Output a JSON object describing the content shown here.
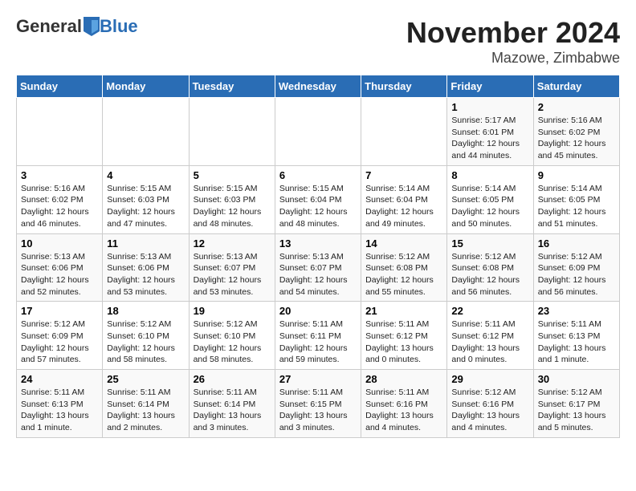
{
  "header": {
    "logo_general": "General",
    "logo_blue": "Blue",
    "title": "November 2024",
    "subtitle": "Mazowe, Zimbabwe"
  },
  "days_of_week": [
    "Sunday",
    "Monday",
    "Tuesday",
    "Wednesday",
    "Thursday",
    "Friday",
    "Saturday"
  ],
  "weeks": [
    [
      {
        "day": "",
        "info": ""
      },
      {
        "day": "",
        "info": ""
      },
      {
        "day": "",
        "info": ""
      },
      {
        "day": "",
        "info": ""
      },
      {
        "day": "",
        "info": ""
      },
      {
        "day": "1",
        "info": "Sunrise: 5:17 AM\nSunset: 6:01 PM\nDaylight: 12 hours\nand 44 minutes."
      },
      {
        "day": "2",
        "info": "Sunrise: 5:16 AM\nSunset: 6:02 PM\nDaylight: 12 hours\nand 45 minutes."
      }
    ],
    [
      {
        "day": "3",
        "info": "Sunrise: 5:16 AM\nSunset: 6:02 PM\nDaylight: 12 hours\nand 46 minutes."
      },
      {
        "day": "4",
        "info": "Sunrise: 5:15 AM\nSunset: 6:03 PM\nDaylight: 12 hours\nand 47 minutes."
      },
      {
        "day": "5",
        "info": "Sunrise: 5:15 AM\nSunset: 6:03 PM\nDaylight: 12 hours\nand 48 minutes."
      },
      {
        "day": "6",
        "info": "Sunrise: 5:15 AM\nSunset: 6:04 PM\nDaylight: 12 hours\nand 48 minutes."
      },
      {
        "day": "7",
        "info": "Sunrise: 5:14 AM\nSunset: 6:04 PM\nDaylight: 12 hours\nand 49 minutes."
      },
      {
        "day": "8",
        "info": "Sunrise: 5:14 AM\nSunset: 6:05 PM\nDaylight: 12 hours\nand 50 minutes."
      },
      {
        "day": "9",
        "info": "Sunrise: 5:14 AM\nSunset: 6:05 PM\nDaylight: 12 hours\nand 51 minutes."
      }
    ],
    [
      {
        "day": "10",
        "info": "Sunrise: 5:13 AM\nSunset: 6:06 PM\nDaylight: 12 hours\nand 52 minutes."
      },
      {
        "day": "11",
        "info": "Sunrise: 5:13 AM\nSunset: 6:06 PM\nDaylight: 12 hours\nand 53 minutes."
      },
      {
        "day": "12",
        "info": "Sunrise: 5:13 AM\nSunset: 6:07 PM\nDaylight: 12 hours\nand 53 minutes."
      },
      {
        "day": "13",
        "info": "Sunrise: 5:13 AM\nSunset: 6:07 PM\nDaylight: 12 hours\nand 54 minutes."
      },
      {
        "day": "14",
        "info": "Sunrise: 5:12 AM\nSunset: 6:08 PM\nDaylight: 12 hours\nand 55 minutes."
      },
      {
        "day": "15",
        "info": "Sunrise: 5:12 AM\nSunset: 6:08 PM\nDaylight: 12 hours\nand 56 minutes."
      },
      {
        "day": "16",
        "info": "Sunrise: 5:12 AM\nSunset: 6:09 PM\nDaylight: 12 hours\nand 56 minutes."
      }
    ],
    [
      {
        "day": "17",
        "info": "Sunrise: 5:12 AM\nSunset: 6:09 PM\nDaylight: 12 hours\nand 57 minutes."
      },
      {
        "day": "18",
        "info": "Sunrise: 5:12 AM\nSunset: 6:10 PM\nDaylight: 12 hours\nand 58 minutes."
      },
      {
        "day": "19",
        "info": "Sunrise: 5:12 AM\nSunset: 6:10 PM\nDaylight: 12 hours\nand 58 minutes."
      },
      {
        "day": "20",
        "info": "Sunrise: 5:11 AM\nSunset: 6:11 PM\nDaylight: 12 hours\nand 59 minutes."
      },
      {
        "day": "21",
        "info": "Sunrise: 5:11 AM\nSunset: 6:12 PM\nDaylight: 13 hours\nand 0 minutes."
      },
      {
        "day": "22",
        "info": "Sunrise: 5:11 AM\nSunset: 6:12 PM\nDaylight: 13 hours\nand 0 minutes."
      },
      {
        "day": "23",
        "info": "Sunrise: 5:11 AM\nSunset: 6:13 PM\nDaylight: 13 hours\nand 1 minute."
      }
    ],
    [
      {
        "day": "24",
        "info": "Sunrise: 5:11 AM\nSunset: 6:13 PM\nDaylight: 13 hours\nand 1 minute."
      },
      {
        "day": "25",
        "info": "Sunrise: 5:11 AM\nSunset: 6:14 PM\nDaylight: 13 hours\nand 2 minutes."
      },
      {
        "day": "26",
        "info": "Sunrise: 5:11 AM\nSunset: 6:14 PM\nDaylight: 13 hours\nand 3 minutes."
      },
      {
        "day": "27",
        "info": "Sunrise: 5:11 AM\nSunset: 6:15 PM\nDaylight: 13 hours\nand 3 minutes."
      },
      {
        "day": "28",
        "info": "Sunrise: 5:11 AM\nSunset: 6:16 PM\nDaylight: 13 hours\nand 4 minutes."
      },
      {
        "day": "29",
        "info": "Sunrise: 5:12 AM\nSunset: 6:16 PM\nDaylight: 13 hours\nand 4 minutes."
      },
      {
        "day": "30",
        "info": "Sunrise: 5:12 AM\nSunset: 6:17 PM\nDaylight: 13 hours\nand 5 minutes."
      }
    ]
  ]
}
